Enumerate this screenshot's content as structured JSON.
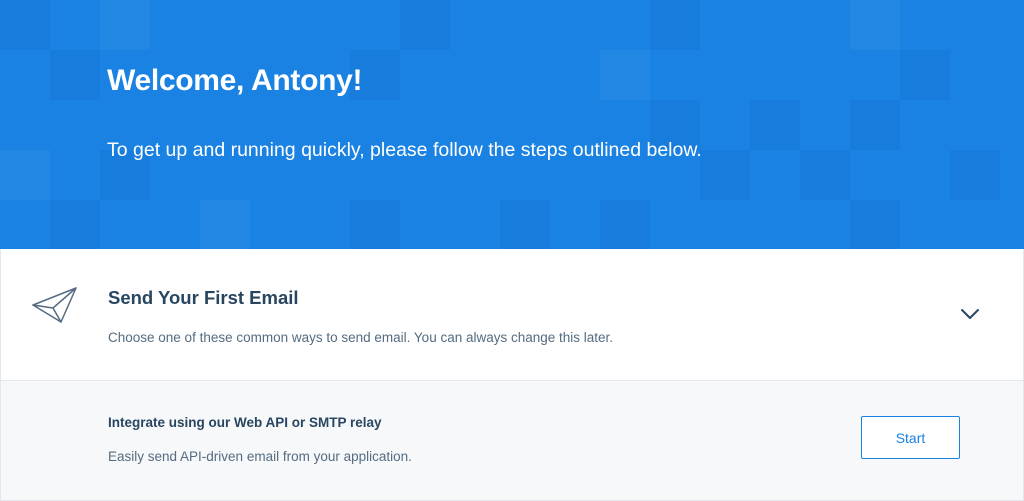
{
  "hero": {
    "title": "Welcome, Antony!",
    "subtitle": "To get up and running quickly, please follow the steps outlined below.",
    "background_color": "#1a82e2"
  },
  "step": {
    "icon": "paper-plane-icon",
    "title": "Send Your First Email",
    "description": "Choose one of these common ways to send email. You can always change this later.",
    "toggle_icon": "chevron-down-icon"
  },
  "option": {
    "title": "Integrate using our Web API or SMTP relay",
    "description": "Easily send API-driven email from your application.",
    "button_label": "Start"
  },
  "colors": {
    "accent": "#1a82e2",
    "heading_text": "#294661",
    "body_text": "#546b81",
    "option_background": "#f7f8f9"
  }
}
